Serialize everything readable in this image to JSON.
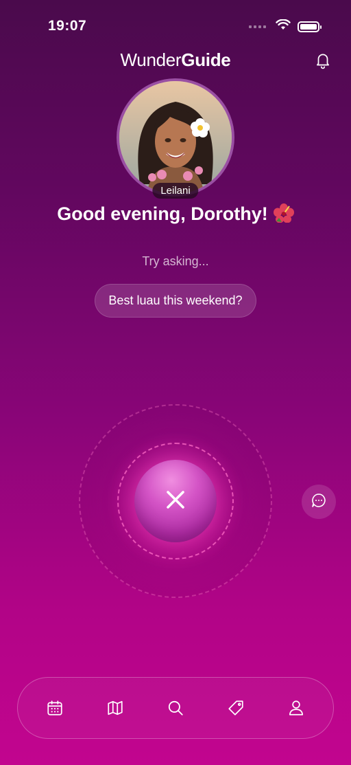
{
  "status_bar": {
    "time": "19:07",
    "battery_level": 1.0
  },
  "header": {
    "brand_light": "Wunder",
    "brand_bold": "Guide"
  },
  "guide": {
    "name": "Leilani"
  },
  "greeting": {
    "text": "Good evening, Dorothy!"
  },
  "prompt": {
    "label": "Try asking...",
    "suggestion": "Best luau this weekend?"
  },
  "voice": {
    "state": "listening"
  },
  "colors": {
    "accent": "#c2058f",
    "background_top": "#4a0a4c",
    "mic": "#d454c6"
  },
  "icons": {
    "status": [
      "signal-icon",
      "wifi-icon",
      "battery-icon"
    ],
    "header": "bell-icon",
    "voice": "close-icon",
    "side": "chat-bubble-icon",
    "tabs": [
      "calendar-icon",
      "map-icon",
      "search-icon",
      "tag-icon",
      "profile-icon"
    ]
  }
}
